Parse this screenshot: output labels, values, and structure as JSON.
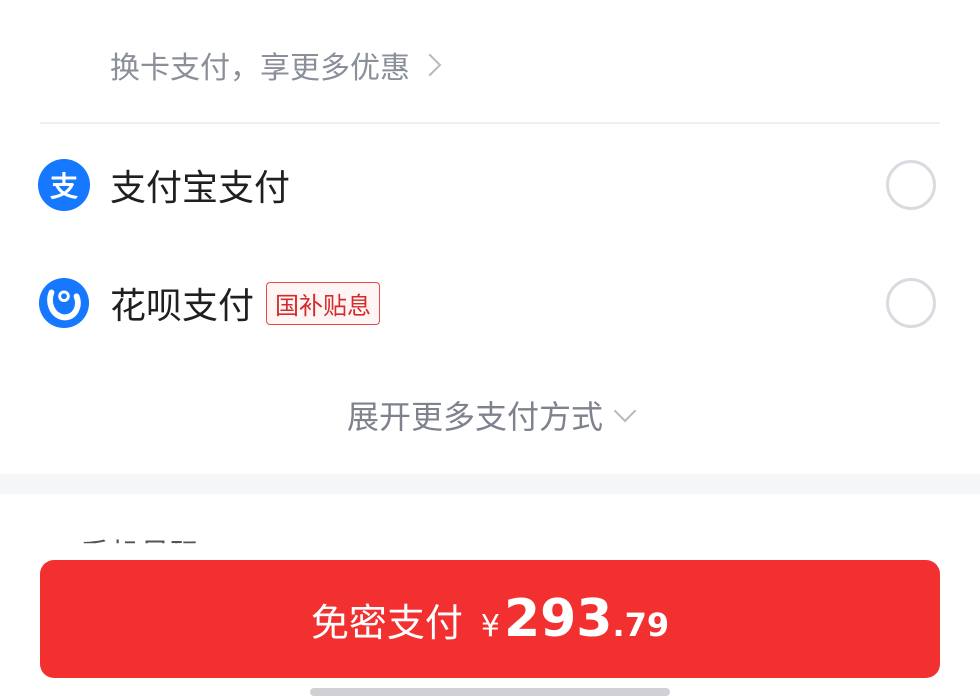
{
  "change_card": {
    "label": "换卡支付，享更多优惠"
  },
  "payment_methods": [
    {
      "name": "支付宝支付",
      "logo_char": "支"
    },
    {
      "name": "花呗支付",
      "badge": "国补贴息"
    }
  ],
  "expand": {
    "label": "展开更多支付方式"
  },
  "hidden_row": {
    "text": "手机号码"
  },
  "pay_button": {
    "label": "免密支付",
    "currency": "¥",
    "amount_int": "293",
    "amount_dec": ".79"
  },
  "colors": {
    "accent": "#f23030",
    "alipay_blue": "#1677ff",
    "badge_red": "#d42c2c"
  },
  "icons": [
    "chevron-right-icon",
    "alipay-logo",
    "huabei-logo",
    "radio-unchecked-icon",
    "chevron-down-icon"
  ]
}
